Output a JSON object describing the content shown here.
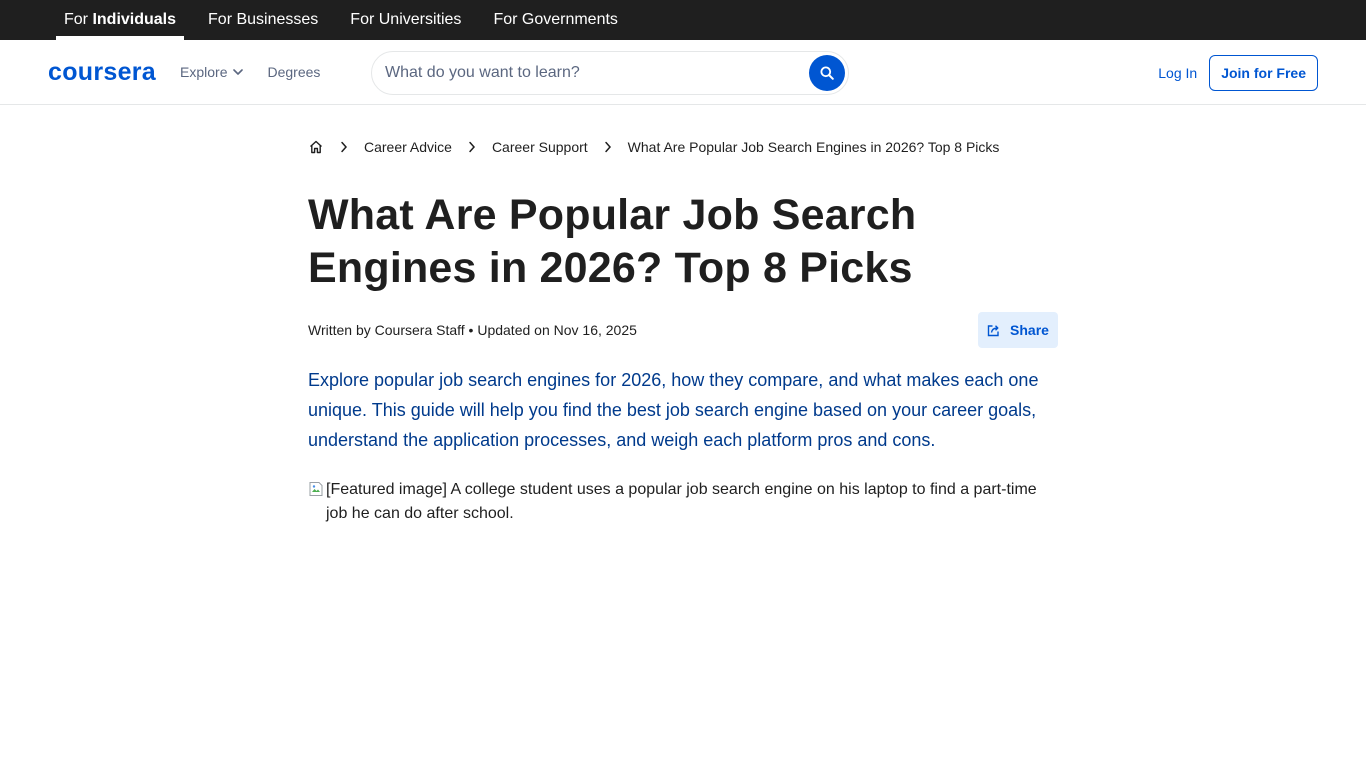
{
  "audience_bar": {
    "tabs": [
      {
        "prefix": "For ",
        "bold": "Individuals",
        "active": true
      },
      {
        "label": "For Businesses"
      },
      {
        "label": "For Universities"
      },
      {
        "label": "For Governments"
      }
    ]
  },
  "header": {
    "logo": "coursera",
    "explore_label": "Explore",
    "degrees_label": "Degrees",
    "search_placeholder": "What do you want to learn?",
    "login_label": "Log In",
    "join_label": "Join for Free"
  },
  "breadcrumb": {
    "items": [
      "Career Advice",
      "Career Support",
      "What Are Popular Job Search Engines in 2026? Top 8 Picks"
    ]
  },
  "article": {
    "title": "What Are Popular Job Search Engines in 2026? Top 8 Picks",
    "byline": "Written by Coursera Staff • Updated on Nov 16, 2025",
    "share_label": "Share",
    "intro": "Explore popular job search engines for 2026, how they compare, and what makes each one unique. This guide will help you find the best job search engine based on your career goals, understand the application processes, and weigh each platform pros and cons.",
    "featured_image_alt": "[Featured image] A college student uses a popular job search engine on his laptop to find a part-time job he can do after school."
  },
  "colors": {
    "brand": "#0056d2",
    "intro_text": "#003a8c",
    "top_bar": "#1f1f1f",
    "share_bg": "#e3effd"
  }
}
